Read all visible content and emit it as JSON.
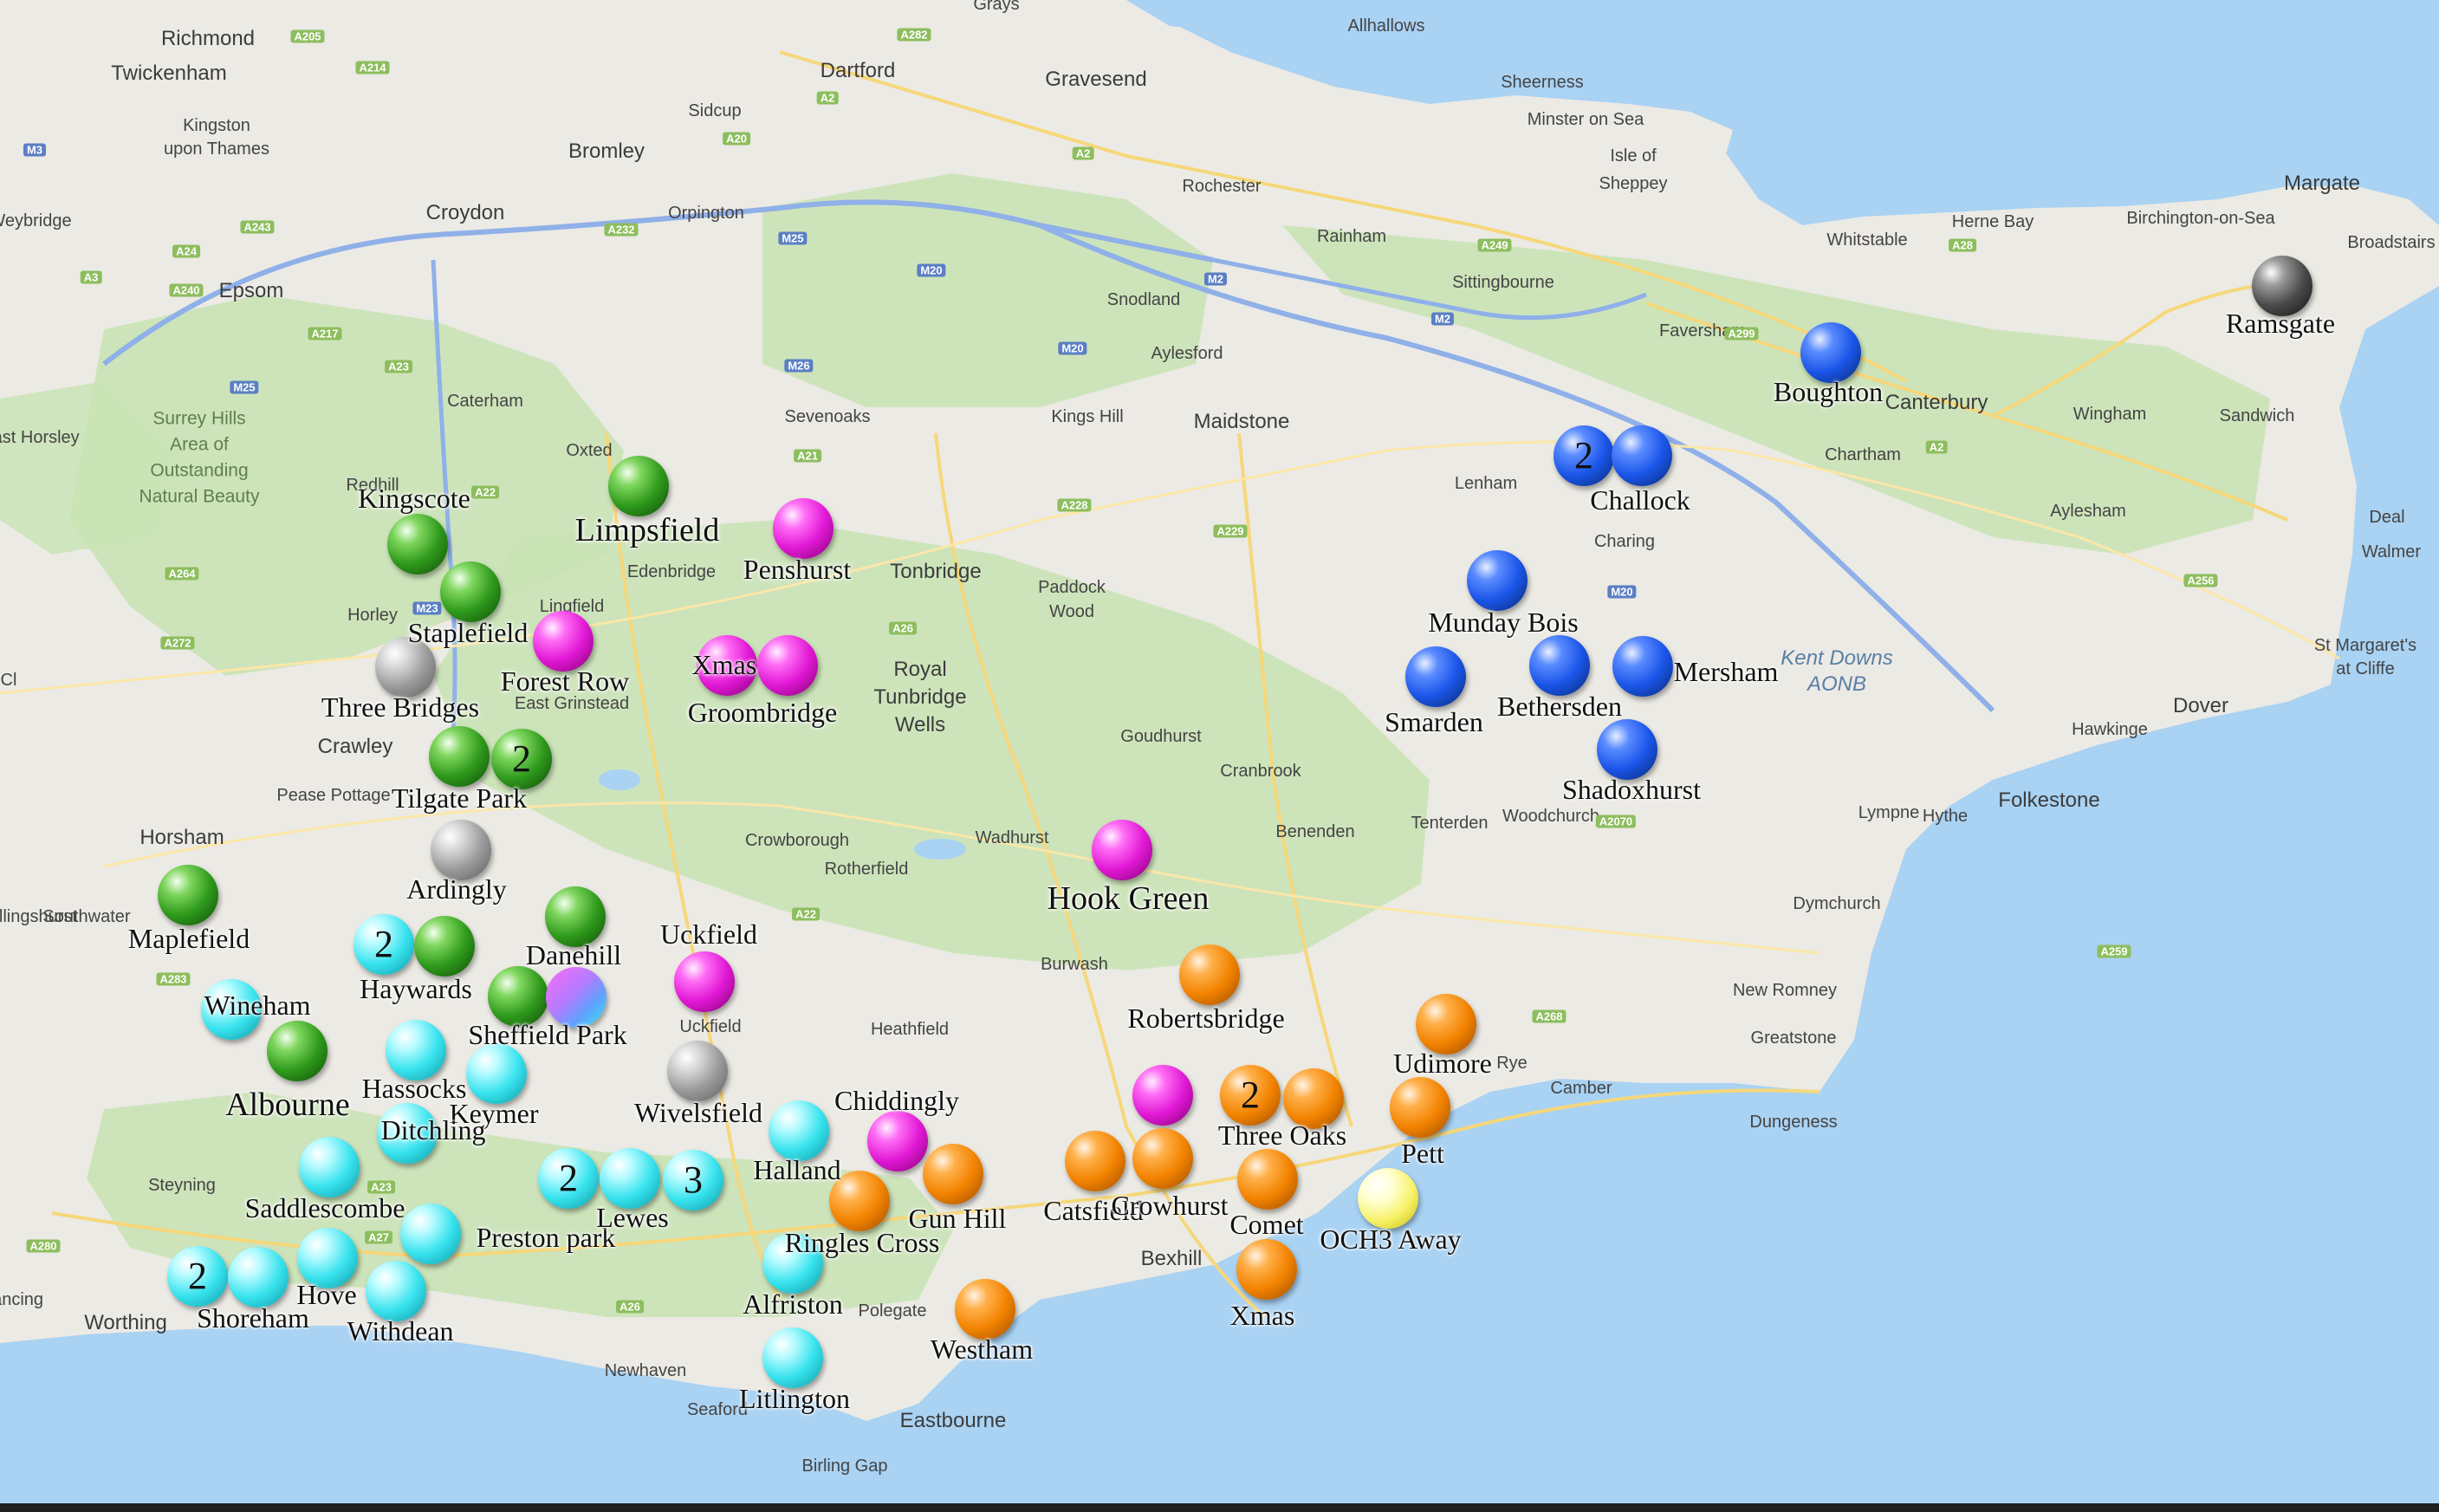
{
  "base_labels": [
    {
      "id": "richmond",
      "text": "Richmond"
    },
    {
      "id": "twickenham",
      "text": "Twickenham"
    },
    {
      "id": "kingston",
      "text": "Kingston"
    },
    {
      "id": "uponthames",
      "text": "upon Thames"
    },
    {
      "id": "dartford",
      "text": "Dartford"
    },
    {
      "id": "gravesend",
      "text": "Gravesend"
    },
    {
      "id": "grays",
      "text": "Grays"
    },
    {
      "id": "allhallows",
      "text": "Allhallows"
    },
    {
      "id": "sheerness",
      "text": "Sheerness"
    },
    {
      "id": "minsteronsea",
      "text": "Minster on Sea"
    },
    {
      "id": "isleof",
      "text": "Isle of"
    },
    {
      "id": "sheppey",
      "text": "Sheppey"
    },
    {
      "id": "sidcup",
      "text": "Sidcup"
    },
    {
      "id": "bromley",
      "text": "Bromley"
    },
    {
      "id": "croydon",
      "text": "Croydon"
    },
    {
      "id": "orpington",
      "text": "Orpington"
    },
    {
      "id": "rochester",
      "text": "Rochester"
    },
    {
      "id": "rainham",
      "text": "Rainham"
    },
    {
      "id": "margate",
      "text": "Margate"
    },
    {
      "id": "herneBay",
      "text": "Herne Bay"
    },
    {
      "id": "whitstable",
      "text": "Whitstable"
    },
    {
      "id": "birchington",
      "text": "Birchington-on-Sea"
    },
    {
      "id": "broadstairs",
      "text": "Broadstairs"
    },
    {
      "id": "epsom",
      "text": "Epsom"
    },
    {
      "id": "sittingbourne",
      "text": "Sittingbourne"
    },
    {
      "id": "snodland",
      "text": "Snodland"
    },
    {
      "id": "aylesford",
      "text": "Aylesford"
    },
    {
      "id": "faversham",
      "text": "Faversham"
    },
    {
      "id": "canterbury",
      "text": "Canterbury"
    },
    {
      "id": "caterham",
      "text": "Caterham"
    },
    {
      "id": "surreyhills1",
      "text": "Surrey Hills"
    },
    {
      "id": "surreyhills2",
      "text": "Area of"
    },
    {
      "id": "surreyhills3",
      "text": "Outstanding"
    },
    {
      "id": "surreyhills4",
      "text": "Natural Beauty"
    },
    {
      "id": "sevenoaks",
      "text": "Sevenoaks"
    },
    {
      "id": "kingshill",
      "text": "Kings Hill"
    },
    {
      "id": "maidstone",
      "text": "Maidstone"
    },
    {
      "id": "wingham",
      "text": "Wingham"
    },
    {
      "id": "sandwich",
      "text": "Sandwich"
    },
    {
      "id": "oxted",
      "text": "Oxted"
    },
    {
      "id": "lenham",
      "text": "Lenham"
    },
    {
      "id": "chartham",
      "text": "Chartham"
    },
    {
      "id": "redhill",
      "text": "Redhill"
    },
    {
      "id": "edenbridge",
      "text": "Edenbridge"
    },
    {
      "id": "tonbridge",
      "text": "Tonbridge"
    },
    {
      "id": "charing",
      "text": "Charing"
    },
    {
      "id": "aylesham",
      "text": "Aylesham"
    },
    {
      "id": "horley",
      "text": "Horley"
    },
    {
      "id": "lingfield",
      "text": "Lingfield"
    },
    {
      "id": "paddockwood1",
      "text": "Paddock"
    },
    {
      "id": "paddockwood2",
      "text": "Wood"
    },
    {
      "id": "deal",
      "text": "Deal"
    },
    {
      "id": "walmer",
      "text": "Walmer"
    },
    {
      "id": "stmargarets1",
      "text": "St Margaret's"
    },
    {
      "id": "stmargarets2",
      "text": "at Cliffe"
    },
    {
      "id": "kentdowns1",
      "text": "Kent Downs"
    },
    {
      "id": "kentdowns2",
      "text": "AONB"
    },
    {
      "id": "royal",
      "text": "Royal"
    },
    {
      "id": "tunbridge",
      "text": "Tunbridge"
    },
    {
      "id": "wells",
      "text": "Wells"
    },
    {
      "id": "crawley",
      "text": "Crawley"
    },
    {
      "id": "eastgrinstead",
      "text": "East Grinstead"
    },
    {
      "id": "dover",
      "text": "Dover"
    },
    {
      "id": "goudhurst",
      "text": "Goudhurst"
    },
    {
      "id": "cranbrook",
      "text": "Cranbrook"
    },
    {
      "id": "hawkinge",
      "text": "Hawkinge"
    },
    {
      "id": "peasepottage",
      "text": "Pease Pottage"
    },
    {
      "id": "horsham",
      "text": "Horsham"
    },
    {
      "id": "crowborough",
      "text": "Crowborough"
    },
    {
      "id": "rotherfield",
      "text": "Rotherfield"
    },
    {
      "id": "wadhurst",
      "text": "Wadhurst"
    },
    {
      "id": "benenden",
      "text": "Benenden"
    },
    {
      "id": "tenterden",
      "text": "Tenterden"
    },
    {
      "id": "woodchurch",
      "text": "Woodchurch"
    },
    {
      "id": "lympne",
      "text": "Lympne"
    },
    {
      "id": "hythe",
      "text": "Hythe"
    },
    {
      "id": "folkestone",
      "text": "Folkestone"
    },
    {
      "id": "southwater",
      "text": "Southwater"
    },
    {
      "id": "dymchurch",
      "text": "Dymchurch"
    },
    {
      "id": "burwash",
      "text": "Burwash"
    },
    {
      "id": "newromney",
      "text": "New Romney"
    },
    {
      "id": "heathfield",
      "text": "Heathfield"
    },
    {
      "id": "uckfieldsmall",
      "text": "Uckfield"
    },
    {
      "id": "greatstone",
      "text": "Greatstone"
    },
    {
      "id": "rye",
      "text": "Rye"
    },
    {
      "id": "camber",
      "text": "Camber"
    },
    {
      "id": "steyning",
      "text": "Steyning"
    },
    {
      "id": "dungeness",
      "text": "Dungeness"
    },
    {
      "id": "bexhill",
      "text": "Bexhill"
    },
    {
      "id": "worthing",
      "text": "Worthing"
    },
    {
      "id": "polegate",
      "text": "Polegate"
    },
    {
      "id": "newhaven",
      "text": "Newhaven"
    },
    {
      "id": "seaford",
      "text": "Seaford"
    },
    {
      "id": "eastbourne",
      "text": "Eastbourne"
    },
    {
      "id": "birlinggap",
      "text": "Birling Gap"
    },
    {
      "id": "weybridge",
      "text": "Weybridge"
    },
    {
      "id": "eastHorsley",
      "text": "East Horsley"
    },
    {
      "id": "billingshurst",
      "text": "Billingshurst"
    },
    {
      "id": "lancing",
      "text": "Lancing"
    },
    {
      "id": "cl",
      "text": "Cl"
    }
  ],
  "road_labels": [
    {
      "id": "a205",
      "text": "A205",
      "kind": "a"
    },
    {
      "id": "a282",
      "text": "A282",
      "kind": "a"
    },
    {
      "id": "a2",
      "text": "A2",
      "kind": "a"
    },
    {
      "id": "a214",
      "text": "A214",
      "kind": "a"
    },
    {
      "id": "a20",
      "text": "A20",
      "kind": "a"
    },
    {
      "id": "a2b",
      "text": "A2",
      "kind": "a"
    },
    {
      "id": "m3",
      "text": "M3",
      "kind": "m"
    },
    {
      "id": "a240",
      "text": "A240",
      "kind": "a"
    },
    {
      "id": "a24",
      "text": "A24",
      "kind": "a"
    },
    {
      "id": "a232",
      "text": "A232",
      "kind": "a"
    },
    {
      "id": "m25a",
      "text": "M25",
      "kind": "m"
    },
    {
      "id": "m20a",
      "text": "M20",
      "kind": "m"
    },
    {
      "id": "m2",
      "text": "M2",
      "kind": "m"
    },
    {
      "id": "a249",
      "text": "A249",
      "kind": "a"
    },
    {
      "id": "a299",
      "text": "A299",
      "kind": "a"
    },
    {
      "id": "a28",
      "text": "A28",
      "kind": "a"
    },
    {
      "id": "a3",
      "text": "A3",
      "kind": "a"
    },
    {
      "id": "a243",
      "text": "A243",
      "kind": "a"
    },
    {
      "id": "m26",
      "text": "M26",
      "kind": "m"
    },
    {
      "id": "m20b",
      "text": "M20",
      "kind": "m"
    },
    {
      "id": "m2b",
      "text": "M2",
      "kind": "m"
    },
    {
      "id": "m25b",
      "text": "M25",
      "kind": "m"
    },
    {
      "id": "a217",
      "text": "A217",
      "kind": "a"
    },
    {
      "id": "a23",
      "text": "A23",
      "kind": "a"
    },
    {
      "id": "a21",
      "text": "A21",
      "kind": "a"
    },
    {
      "id": "a2b2",
      "text": "A2",
      "kind": "a"
    },
    {
      "id": "m23",
      "text": "M23",
      "kind": "m"
    },
    {
      "id": "a22",
      "text": "A22",
      "kind": "a"
    },
    {
      "id": "a26",
      "text": "A26",
      "kind": "a"
    },
    {
      "id": "a228",
      "text": "A228",
      "kind": "a"
    },
    {
      "id": "a229",
      "text": "A229",
      "kind": "a"
    },
    {
      "id": "m20c",
      "text": "M20",
      "kind": "m"
    },
    {
      "id": "a256",
      "text": "A256",
      "kind": "a"
    },
    {
      "id": "a264",
      "text": "A264",
      "kind": "a"
    },
    {
      "id": "a272",
      "text": "A272",
      "kind": "a"
    },
    {
      "id": "a2070",
      "text": "A2070",
      "kind": "a"
    },
    {
      "id": "a259",
      "text": "A259",
      "kind": "a"
    },
    {
      "id": "a268",
      "text": "A268",
      "kind": "a"
    },
    {
      "id": "a283",
      "text": "A283",
      "kind": "a"
    },
    {
      "id": "a26b",
      "text": "A26",
      "kind": "a"
    },
    {
      "id": "a27",
      "text": "A27",
      "kind": "a"
    },
    {
      "id": "a280",
      "text": "A280",
      "kind": "a"
    },
    {
      "id": "a22b",
      "text": "A22",
      "kind": "a"
    },
    {
      "id": "a23b",
      "text": "A23",
      "kind": "a"
    }
  ],
  "markers": [
    {
      "id": "limpsfield",
      "color": "green",
      "count": "",
      "label": "Limpsfield",
      "big": true
    },
    {
      "id": "kingscote",
      "color": "green",
      "count": "",
      "label": "Kingscote"
    },
    {
      "id": "staplefield",
      "color": "green",
      "count": "",
      "label": "Staplefield"
    },
    {
      "id": "threebridges",
      "color": "grey",
      "count": "",
      "label": "Three Bridges"
    },
    {
      "id": "tilgatepark1",
      "color": "green",
      "count": "",
      "label": "Tilgate Park"
    },
    {
      "id": "tilgatepark2",
      "color": "green",
      "count": "2",
      "label": ""
    },
    {
      "id": "ardingly",
      "color": "grey",
      "count": "",
      "label": "Ardingly"
    },
    {
      "id": "maplefield",
      "color": "green",
      "count": "",
      "label": "Maplefield"
    },
    {
      "id": "danehill",
      "color": "green",
      "count": "",
      "label": "Danehill"
    },
    {
      "id": "sheffieldpark1",
      "color": "green",
      "count": "",
      "label": "Sheffield Park"
    },
    {
      "id": "sheffieldpark2",
      "color": "mixed",
      "count": "",
      "label": ""
    },
    {
      "id": "albourne",
      "color": "green",
      "count": "",
      "label": "Albourne",
      "big": true
    },
    {
      "id": "haywards1",
      "color": "cyan",
      "count": "2",
      "label": "Haywards"
    },
    {
      "id": "haywards2",
      "color": "green",
      "count": "",
      "label": ""
    },
    {
      "id": "wineham",
      "color": "cyan",
      "count": "",
      "label": "Wineham"
    },
    {
      "id": "hassocks",
      "color": "cyan",
      "count": "",
      "label": "Hassocks"
    },
    {
      "id": "keymer",
      "color": "cyan",
      "count": "",
      "label": "Keymer"
    },
    {
      "id": "ditchling",
      "color": "cyan",
      "count": "",
      "label": "Ditchling"
    },
    {
      "id": "saddlescombe",
      "color": "cyan",
      "count": "",
      "label": "Saddlescombe"
    },
    {
      "id": "prestonpark",
      "color": "cyan",
      "count": "",
      "label": "Preston park"
    },
    {
      "id": "hove",
      "color": "cyan",
      "count": "",
      "label": "Hove"
    },
    {
      "id": "withdean",
      "color": "cyan",
      "count": "",
      "label": "Withdean"
    },
    {
      "id": "shoreham1",
      "color": "cyan",
      "count": "2",
      "label": "Shoreham"
    },
    {
      "id": "shoreham2",
      "color": "cyan",
      "count": "",
      "label": ""
    },
    {
      "id": "lewes1",
      "color": "cyan",
      "count": "2",
      "label": ""
    },
    {
      "id": "lewes2",
      "color": "cyan",
      "count": "",
      "label": "Lewes"
    },
    {
      "id": "lewes3",
      "color": "cyan",
      "count": "3",
      "label": ""
    },
    {
      "id": "halland",
      "color": "cyan",
      "count": "",
      "label": "Halland"
    },
    {
      "id": "alfriston",
      "color": "cyan",
      "count": "",
      "label": "Alfriston"
    },
    {
      "id": "litlington",
      "color": "cyan",
      "count": "",
      "label": "Litlington"
    },
    {
      "id": "wivelsfield",
      "color": "grey",
      "count": "",
      "label": "Wivelsfield"
    },
    {
      "id": "uckfield",
      "color": "magenta",
      "count": "",
      "label": "Uckfield"
    },
    {
      "id": "forestrow",
      "color": "magenta",
      "count": "",
      "label": "Forest Row"
    },
    {
      "id": "penshurst",
      "color": "magenta",
      "count": "",
      "label": "Penshurst"
    },
    {
      "id": "xmasgroom",
      "color": "magenta",
      "count": "",
      "label": "Xmas"
    },
    {
      "id": "groombridge",
      "color": "magenta",
      "count": "",
      "label": "Groombridge"
    },
    {
      "id": "hookgreen",
      "color": "magenta",
      "count": "",
      "label": "Hook Green",
      "big": true
    },
    {
      "id": "chiddingly",
      "color": "magenta",
      "count": "",
      "label": "Chiddingly"
    },
    {
      "id": "battle",
      "color": "magenta",
      "count": "",
      "label": ""
    },
    {
      "id": "gunhill",
      "color": "orange",
      "count": "",
      "label": "Gun Hill"
    },
    {
      "id": "ringlescross",
      "color": "orange",
      "count": "",
      "label": "Ringles Cross"
    },
    {
      "id": "westham",
      "color": "orange",
      "count": "",
      "label": "Westham"
    },
    {
      "id": "robertsbridge",
      "color": "orange",
      "count": "",
      "label": "Robertsbridge"
    },
    {
      "id": "catsfield",
      "color": "orange",
      "count": "",
      "label": "Catsfield"
    },
    {
      "id": "crowhurst",
      "color": "orange",
      "count": "",
      "label": "Crowhurst"
    },
    {
      "id": "threeoaks1",
      "color": "orange",
      "count": "2",
      "label": "Three Oaks"
    },
    {
      "id": "threeoaks2",
      "color": "orange",
      "count": "",
      "label": ""
    },
    {
      "id": "comet",
      "color": "orange",
      "count": "",
      "label": "Comet"
    },
    {
      "id": "xmashastings",
      "color": "orange",
      "count": "",
      "label": "Xmas"
    },
    {
      "id": "udimore",
      "color": "orange",
      "count": "",
      "label": "Udimore"
    },
    {
      "id": "pett",
      "color": "orange",
      "count": "",
      "label": "Pett"
    },
    {
      "id": "och3away",
      "color": "yellow",
      "count": "",
      "label": "OCH3 Away"
    },
    {
      "id": "boughton",
      "color": "blue",
      "count": "",
      "label": "Boughton"
    },
    {
      "id": "challock1",
      "color": "blue",
      "count": "2",
      "label": ""
    },
    {
      "id": "challock2",
      "color": "blue",
      "count": "",
      "label": "Challock"
    },
    {
      "id": "mundaybois",
      "color": "blue",
      "count": "",
      "label": "Munday Bois"
    },
    {
      "id": "smarden",
      "color": "blue",
      "count": "",
      "label": "Smarden"
    },
    {
      "id": "bethersden",
      "color": "blue",
      "count": "",
      "label": "Bethersden"
    },
    {
      "id": "mersham",
      "color": "blue",
      "count": "",
      "label": "Mersham"
    },
    {
      "id": "shadoxhurst",
      "color": "blue",
      "count": "",
      "label": "Shadoxhurst"
    },
    {
      "id": "ramsgate",
      "color": "dark",
      "count": "",
      "label": "Ramsgate"
    }
  ]
}
